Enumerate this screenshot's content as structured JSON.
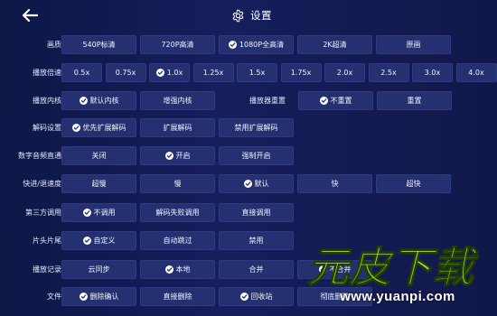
{
  "header": {
    "title": "设置",
    "back_icon": "arrow-left-icon",
    "title_icon": "gear-icon"
  },
  "accent": {
    "button_bg": "#243070",
    "page_bg": "#141c55",
    "check_fill": "#ffffff"
  },
  "rows": [
    {
      "label": "画质",
      "options": [
        {
          "label": "540P标清",
          "checked": false
        },
        {
          "label": "720P高清",
          "checked": false
        },
        {
          "label": "1080P全高清",
          "checked": true
        },
        {
          "label": "2K超清",
          "checked": false
        },
        {
          "label": "原画",
          "checked": false
        }
      ]
    },
    {
      "label": "播放倍速",
      "options": [
        {
          "label": "0.5x",
          "checked": false
        },
        {
          "label": "0.75x",
          "checked": false
        },
        {
          "label": "1.0x",
          "checked": true
        },
        {
          "label": "1.25x",
          "checked": false
        },
        {
          "label": "1.5x",
          "checked": false
        },
        {
          "label": "1.75x",
          "checked": false
        },
        {
          "label": "2.0x",
          "checked": false
        },
        {
          "label": "2.5x",
          "checked": false
        },
        {
          "label": "3.0x",
          "checked": false
        },
        {
          "label": "4.0x",
          "checked": false
        }
      ]
    },
    {
      "label": "播放内核",
      "options": [
        {
          "label": "默认内核",
          "checked": true
        },
        {
          "label": "增强内核",
          "checked": false
        }
      ],
      "secondary": {
        "label": "播放器重置",
        "options": [
          {
            "label": "不重置",
            "checked": true
          },
          {
            "label": "重置",
            "checked": false
          }
        ]
      }
    },
    {
      "label": "解码设置",
      "options": [
        {
          "label": "优先扩展解码",
          "checked": true
        },
        {
          "label": "扩展解码",
          "checked": false
        },
        {
          "label": "禁用扩展解码",
          "checked": false
        }
      ]
    },
    {
      "label": "数字音频直通",
      "options": [
        {
          "label": "关闭",
          "checked": false
        },
        {
          "label": "开启",
          "checked": true
        },
        {
          "label": "强制开启",
          "checked": false
        }
      ]
    },
    {
      "label": "快进/退速度",
      "options": [
        {
          "label": "超慢",
          "checked": false
        },
        {
          "label": "慢",
          "checked": false
        },
        {
          "label": "默认",
          "checked": true
        },
        {
          "label": "快",
          "checked": false
        },
        {
          "label": "超快",
          "checked": false
        }
      ]
    },
    {
      "label": "第三方调用",
      "options": [
        {
          "label": "不调用",
          "checked": true
        },
        {
          "label": "解码失败调用",
          "checked": false
        },
        {
          "label": "直接调用",
          "checked": false
        }
      ]
    },
    {
      "label": "片头片尾",
      "options": [
        {
          "label": "自定义",
          "checked": true
        },
        {
          "label": "自动跳过",
          "checked": false
        },
        {
          "label": "禁用",
          "checked": false
        }
      ]
    },
    {
      "label": "播放记录",
      "options": [
        {
          "label": "云同步",
          "checked": false
        },
        {
          "label": "本地",
          "checked": true
        },
        {
          "label": "合并",
          "checked": false
        },
        {
          "label": "不合并",
          "checked": true
        }
      ]
    },
    {
      "label": "文件",
      "options": [
        {
          "label": "删除确认",
          "checked": true
        },
        {
          "label": "直接删除",
          "checked": false
        },
        {
          "label": "回收站",
          "checked": true
        },
        {
          "label": "彻底删除",
          "checked": false
        }
      ]
    }
  ],
  "watermark": {
    "logo_text": "元皮下载",
    "url": "www.yuanpi.com"
  }
}
